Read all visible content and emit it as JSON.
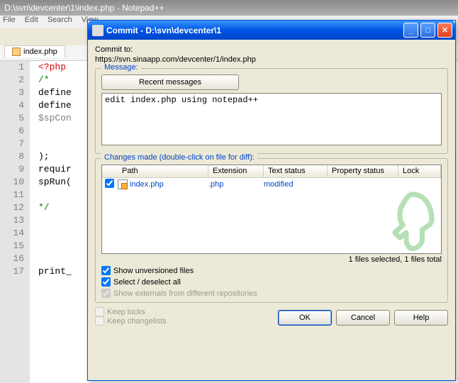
{
  "notepadpp": {
    "title": "D:\\svn\\devcenter\\1\\index.php - Notepad++",
    "menu": [
      "File",
      "Edit",
      "Search",
      "View"
    ],
    "tab": "index.php",
    "lines": [
      {
        "n": 1,
        "cls": "c-red",
        "t": "<?php"
      },
      {
        "n": 2,
        "cls": "c-green",
        "t": "/*"
      },
      {
        "n": 3,
        "cls": "c-black",
        "t": "define"
      },
      {
        "n": 4,
        "cls": "c-black",
        "t": "define"
      },
      {
        "n": 5,
        "cls": "c-gray",
        "t": "$spCon"
      },
      {
        "n": 6,
        "cls": "",
        "t": ""
      },
      {
        "n": 7,
        "cls": "",
        "t": ""
      },
      {
        "n": 8,
        "cls": "c-black",
        "t": ");"
      },
      {
        "n": 9,
        "cls": "c-black",
        "t": "requir"
      },
      {
        "n": 10,
        "cls": "c-black",
        "t": "spRun("
      },
      {
        "n": 11,
        "cls": "",
        "t": ""
      },
      {
        "n": 12,
        "cls": "c-green",
        "t": "*/"
      },
      {
        "n": 13,
        "cls": "",
        "t": ""
      },
      {
        "n": 14,
        "cls": "",
        "t": ""
      },
      {
        "n": 15,
        "cls": "",
        "t": ""
      },
      {
        "n": 16,
        "cls": "",
        "t": ""
      },
      {
        "n": 17,
        "cls": "c-black",
        "t": "print_"
      }
    ]
  },
  "dialog": {
    "title": "Commit - D:\\svn\\devcenter\\1",
    "commit_to_label": "Commit to:",
    "commit_to_url": "https://svn.sinaapp.com/devcenter/1/index.php",
    "message_group": "Message:",
    "recent_messages_btn": "Recent messages",
    "message_text": "edit index.php using notepad++",
    "changes_group": "Changes made (double-click on file for diff):",
    "columns": {
      "path": "Path",
      "ext": "Extension",
      "text": "Text status",
      "prop": "Property status",
      "lock": "Lock"
    },
    "file": {
      "checked": true,
      "name": "index.php",
      "ext": ".php",
      "text": "modified",
      "prop": "",
      "lock": ""
    },
    "status": "1 files selected, 1 files total",
    "show_unversioned": {
      "label": "Show unversioned files",
      "checked": true
    },
    "select_all": {
      "label": "Select / deselect all",
      "checked": true
    },
    "show_externals": {
      "label": "Show externals from different repositories",
      "checked": true
    },
    "keep_locks": {
      "label": "Keep locks",
      "checked": false
    },
    "keep_changelists": {
      "label": "Keep changelists",
      "checked": false
    },
    "ok": "OK",
    "cancel": "Cancel",
    "help": "Help"
  }
}
